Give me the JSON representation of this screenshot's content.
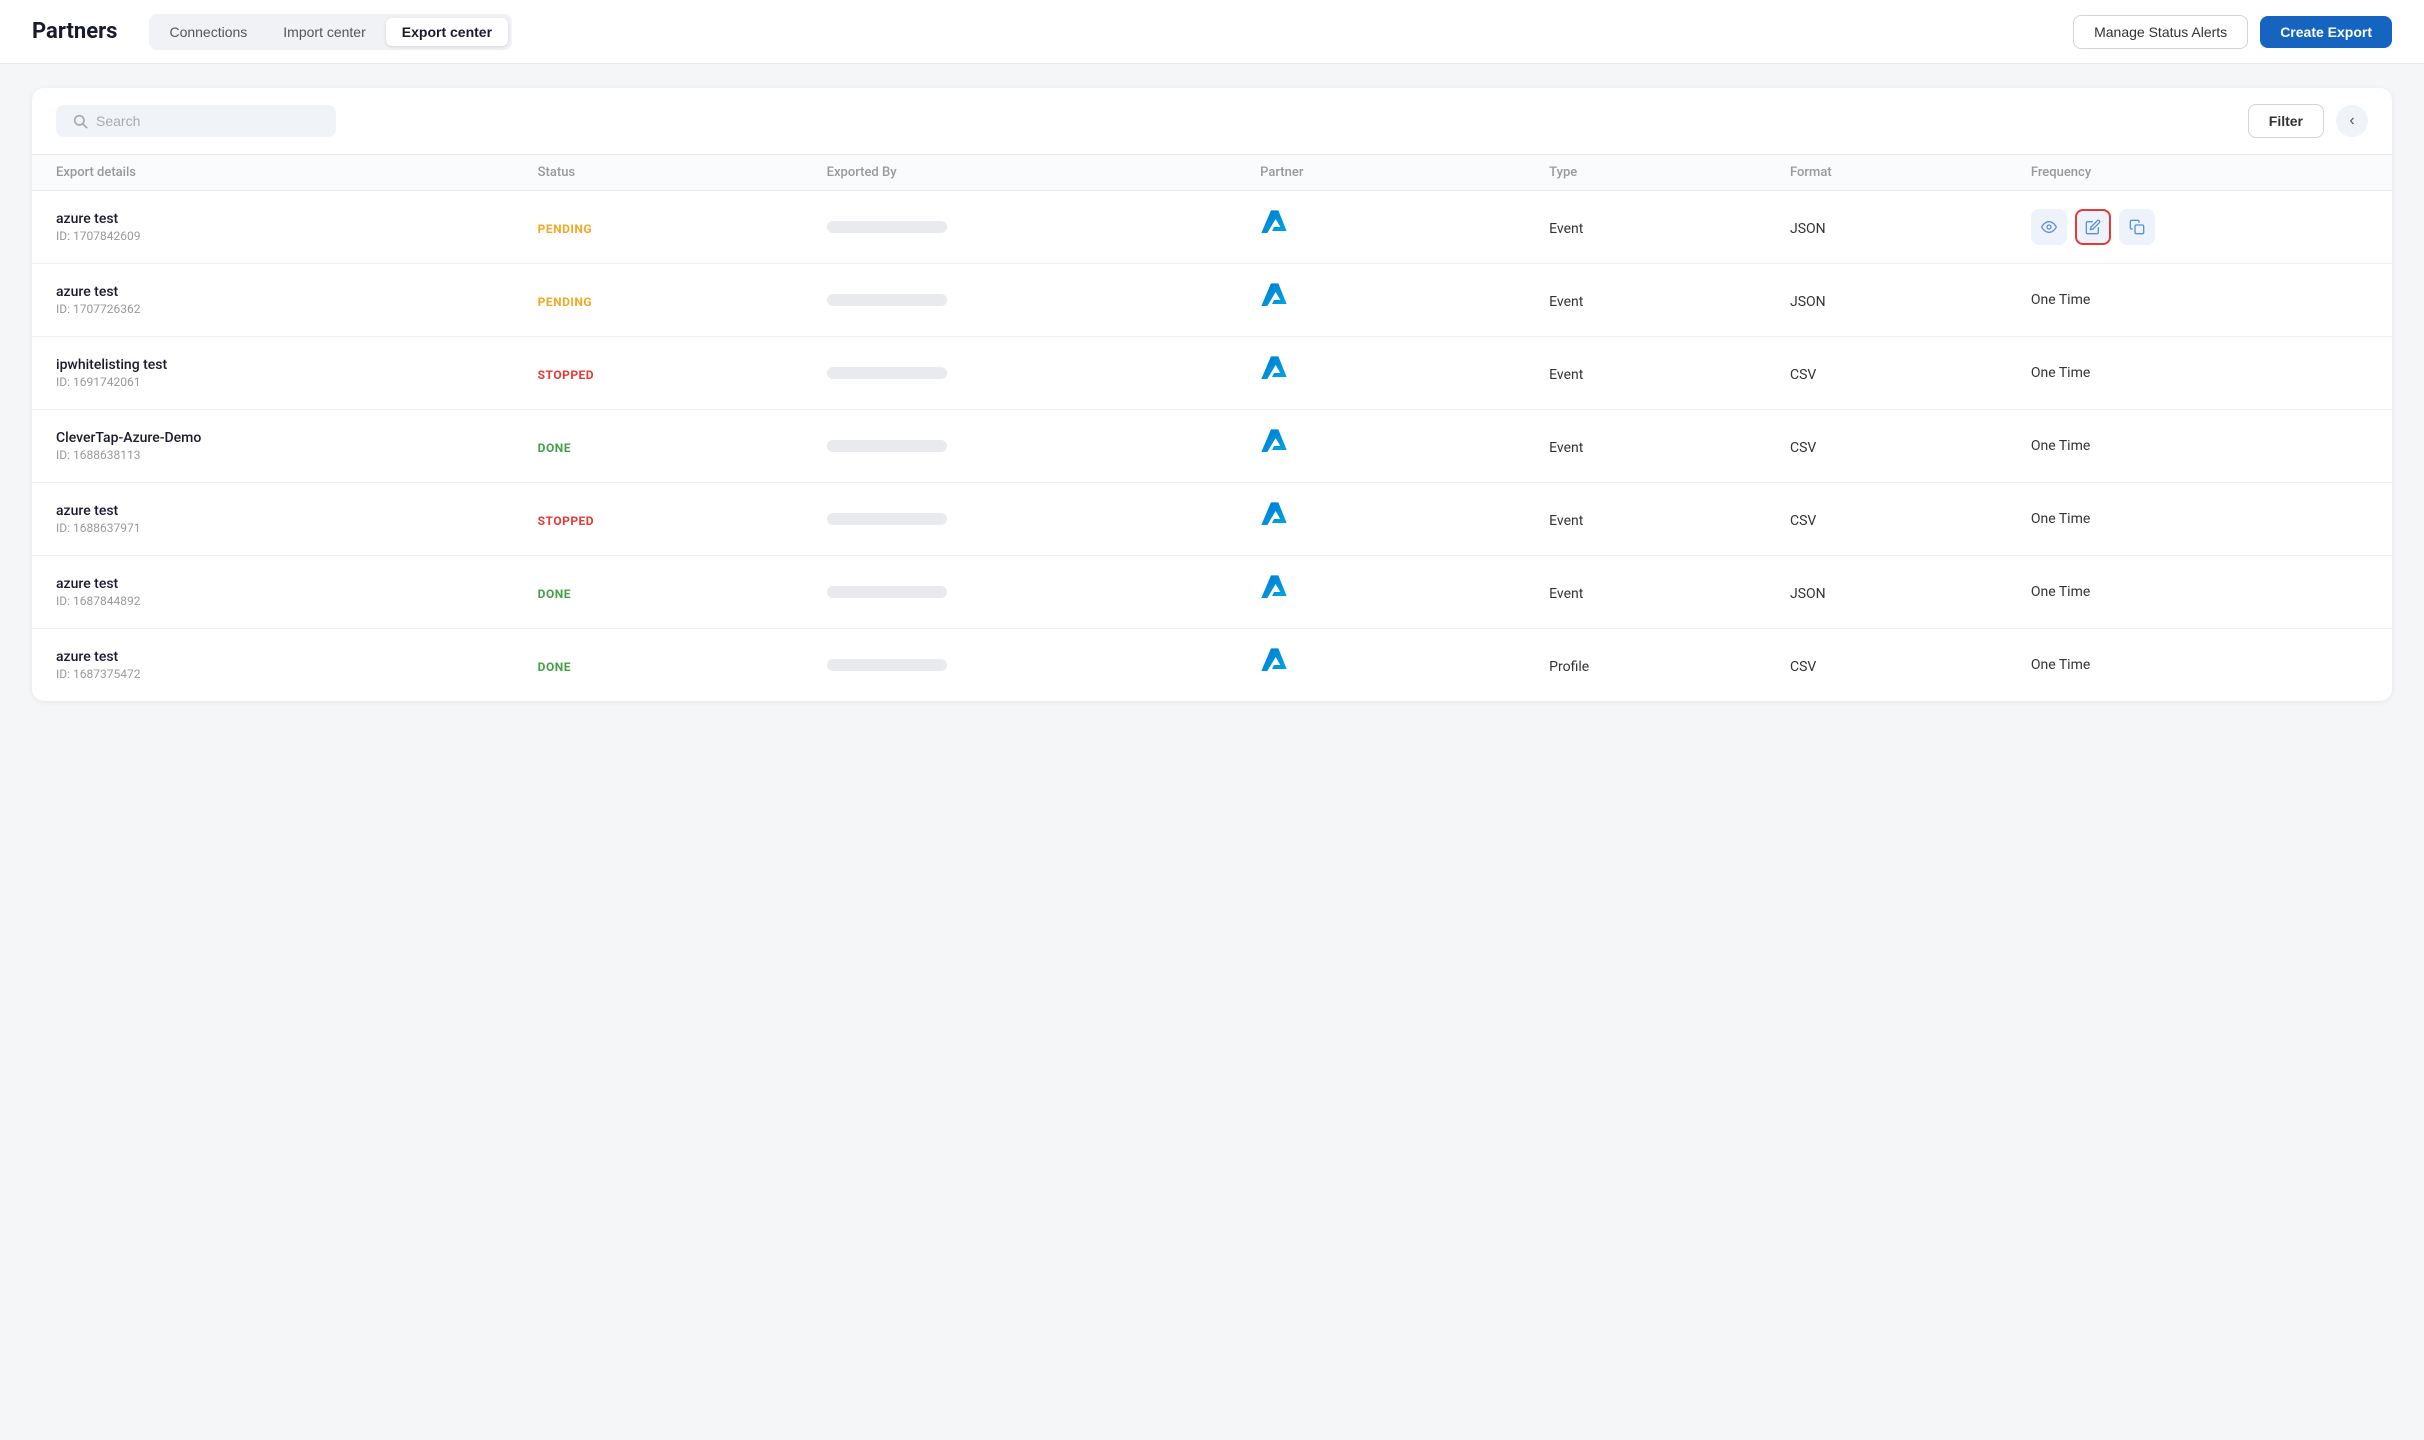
{
  "header": {
    "title": "Partners",
    "tabs": [
      {
        "id": "connections",
        "label": "Connections",
        "active": false
      },
      {
        "id": "import-center",
        "label": "Import center",
        "active": false
      },
      {
        "id": "export-center",
        "label": "Export center",
        "active": true
      }
    ],
    "manage_btn": "Manage Status Alerts",
    "create_btn": "Create Export"
  },
  "search": {
    "placeholder": "Search"
  },
  "filter_btn": "Filter",
  "table": {
    "columns": [
      "Export details",
      "Status",
      "Exported By",
      "Partner",
      "Type",
      "Format",
      "Frequency"
    ],
    "rows": [
      {
        "name": "azure test",
        "id": "ID: 1707842609",
        "status": "PENDING",
        "status_class": "status-pending",
        "type": "Event",
        "format": "JSON",
        "frequency": null,
        "show_actions": true,
        "highlighted_edit": true
      },
      {
        "name": "azure test",
        "id": "ID: 1707726362",
        "status": "PENDING",
        "status_class": "status-pending",
        "type": "Event",
        "format": "JSON",
        "frequency": "One Time",
        "show_actions": false,
        "highlighted_edit": false
      },
      {
        "name": "ipwhitelisting test",
        "id": "ID: 1691742061",
        "status": "STOPPED",
        "status_class": "status-stopped",
        "type": "Event",
        "format": "CSV",
        "frequency": "One Time",
        "show_actions": false,
        "highlighted_edit": false
      },
      {
        "name": "CleverTap-Azure-Demo",
        "id": "ID: 1688638113",
        "status": "DONE",
        "status_class": "status-done",
        "type": "Event",
        "format": "CSV",
        "frequency": "One Time",
        "show_actions": false,
        "highlighted_edit": false
      },
      {
        "name": "azure test",
        "id": "ID: 1688637971",
        "status": "STOPPED",
        "status_class": "status-stopped",
        "type": "Event",
        "format": "CSV",
        "frequency": "One Time",
        "show_actions": false,
        "highlighted_edit": false
      },
      {
        "name": "azure test",
        "id": "ID: 1687844892",
        "status": "DONE",
        "status_class": "status-done",
        "type": "Event",
        "format": "JSON",
        "frequency": "One Time",
        "show_actions": false,
        "highlighted_edit": false
      },
      {
        "name": "azure test",
        "id": "ID: 1687375472",
        "status": "DONE",
        "status_class": "status-done",
        "type": "Profile",
        "format": "CSV",
        "frequency": "One Time",
        "show_actions": false,
        "highlighted_edit": false
      }
    ]
  },
  "icons": {
    "search": "🔍",
    "eye": "👁",
    "edit": "✏",
    "copy": "⧉",
    "chevron_left": "‹"
  },
  "colors": {
    "primary_btn": "#1565c0",
    "pending": "#f5a623",
    "stopped": "#e53935",
    "done": "#43a047",
    "highlight_border": "#e53935"
  }
}
